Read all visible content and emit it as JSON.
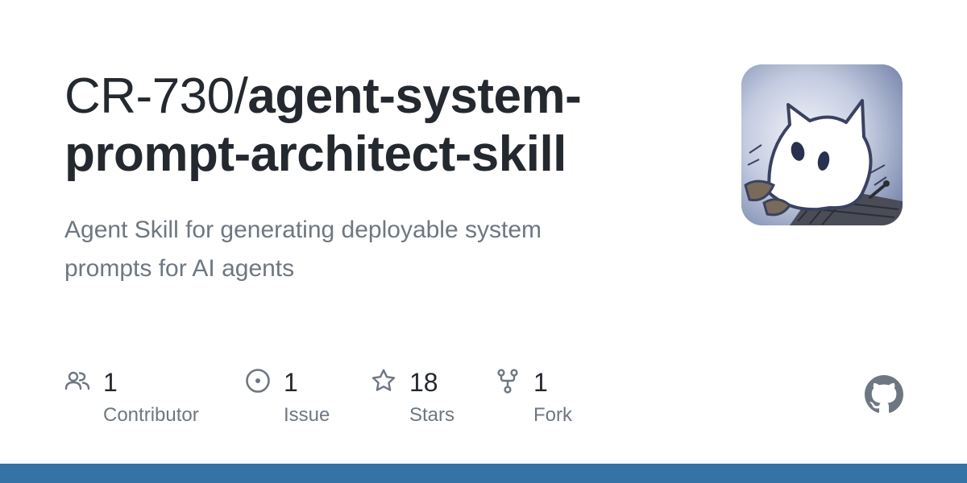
{
  "repo": {
    "owner": "CR-730/",
    "name_line1": "agent-system-",
    "name_line2": "prompt-architect-skill",
    "description_line1": "Agent Skill for generating deployable system",
    "description_line2": "prompts for AI agents"
  },
  "stats": [
    {
      "icon": "contributors-icon",
      "count": "1",
      "label": "Contributor"
    },
    {
      "icon": "issue-icon",
      "count": "1",
      "label": "Issue"
    },
    {
      "icon": "star-icon",
      "count": "18",
      "label": "Stars"
    },
    {
      "icon": "fork-icon",
      "count": "1",
      "label": "Fork"
    }
  ],
  "avatar": {
    "icon": "cat-avatar-image"
  },
  "footer": {
    "icon": "github-mark-icon",
    "language_bar_color": "#3572a5"
  },
  "colors": {
    "text": "#24292f",
    "muted": "#6e7781"
  }
}
